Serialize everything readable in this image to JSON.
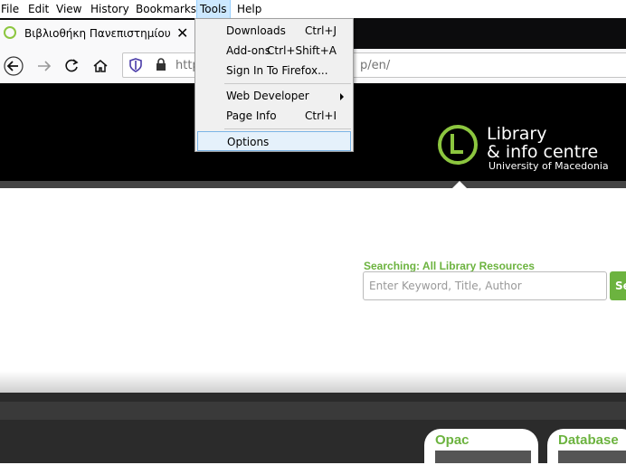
{
  "menubar": {
    "items": [
      "File",
      "Edit",
      "View",
      "History",
      "Bookmarks",
      "Tools",
      "Help"
    ]
  },
  "tab": {
    "title": "Βιβλιοθήκη Πανεπιστημίου Μα",
    "close": "✕"
  },
  "navbar": {
    "url_prefix": "http",
    "url_suffix": "p/en/"
  },
  "tools_menu": {
    "items": [
      {
        "label": "Downloads",
        "shortcut": "Ctrl+J"
      },
      {
        "label": "Add-ons",
        "shortcut": "Ctrl+Shift+A"
      },
      {
        "label": "Sign In To Firefox...",
        "shortcut": ""
      },
      {
        "label": "Web Developer",
        "shortcut": ""
      },
      {
        "label": "Page Info",
        "shortcut": "Ctrl+I"
      },
      {
        "label": "Options",
        "shortcut": ""
      }
    ]
  },
  "logo": {
    "line1": "Library",
    "line2": "& info centre",
    "line3": "University of Macedonia"
  },
  "search": {
    "label": "Searching: All Library Resources",
    "placeholder": "Enter Keyword, Title, Author",
    "button": "Se"
  },
  "cards": [
    {
      "title": "Opac"
    },
    {
      "title": "Database"
    }
  ],
  "colors": {
    "accent_green": "#6cb33f",
    "logo_green": "#8cc63f",
    "header_bg": "#000000",
    "menu_highlight": "#cce8ff"
  }
}
